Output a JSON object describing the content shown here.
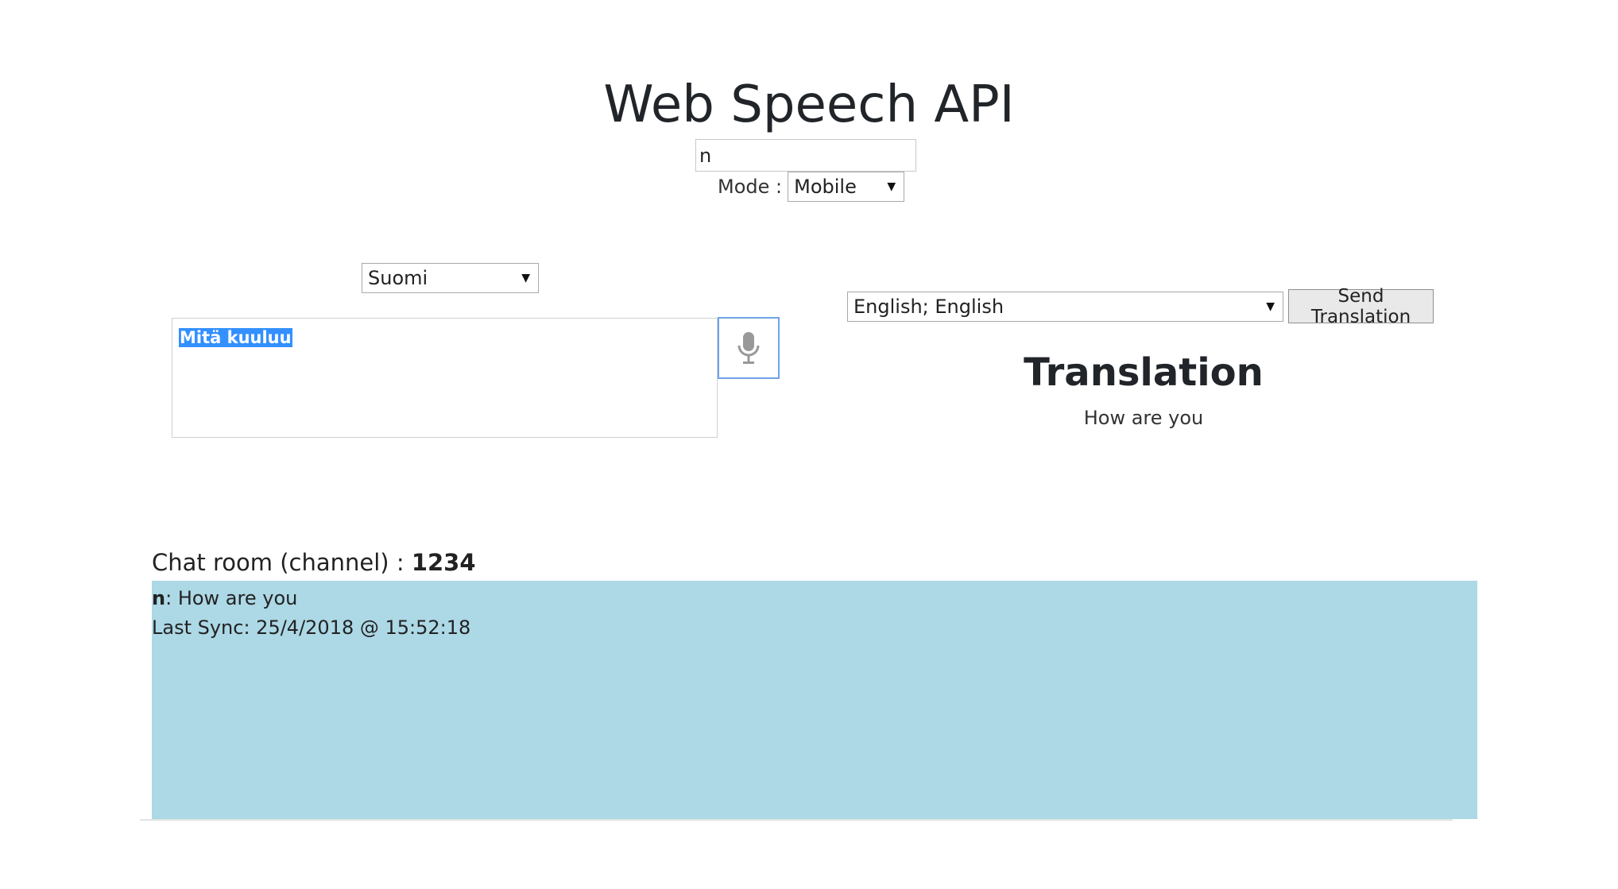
{
  "header": {
    "title": "Web Speech API",
    "name_value": "n",
    "mode_label": "Mode :",
    "mode_value": "Mobile"
  },
  "speech": {
    "source_language": "Suomi",
    "final_text": "Mitä kuuluu",
    "mic_icon": "microphone-icon"
  },
  "translation": {
    "target_language": "English; English",
    "send_label": "Send Translation",
    "heading": "Translation",
    "text": "How are you"
  },
  "chat": {
    "heading_label": "Chat room (channel) : ",
    "channel": "1234",
    "messages": [
      {
        "user": "n",
        "separator": ": ",
        "text": "How are you"
      }
    ],
    "last_sync": "Last Sync: 25/4/2018 @ 15:52:18",
    "panel_color": "#add8e6"
  }
}
